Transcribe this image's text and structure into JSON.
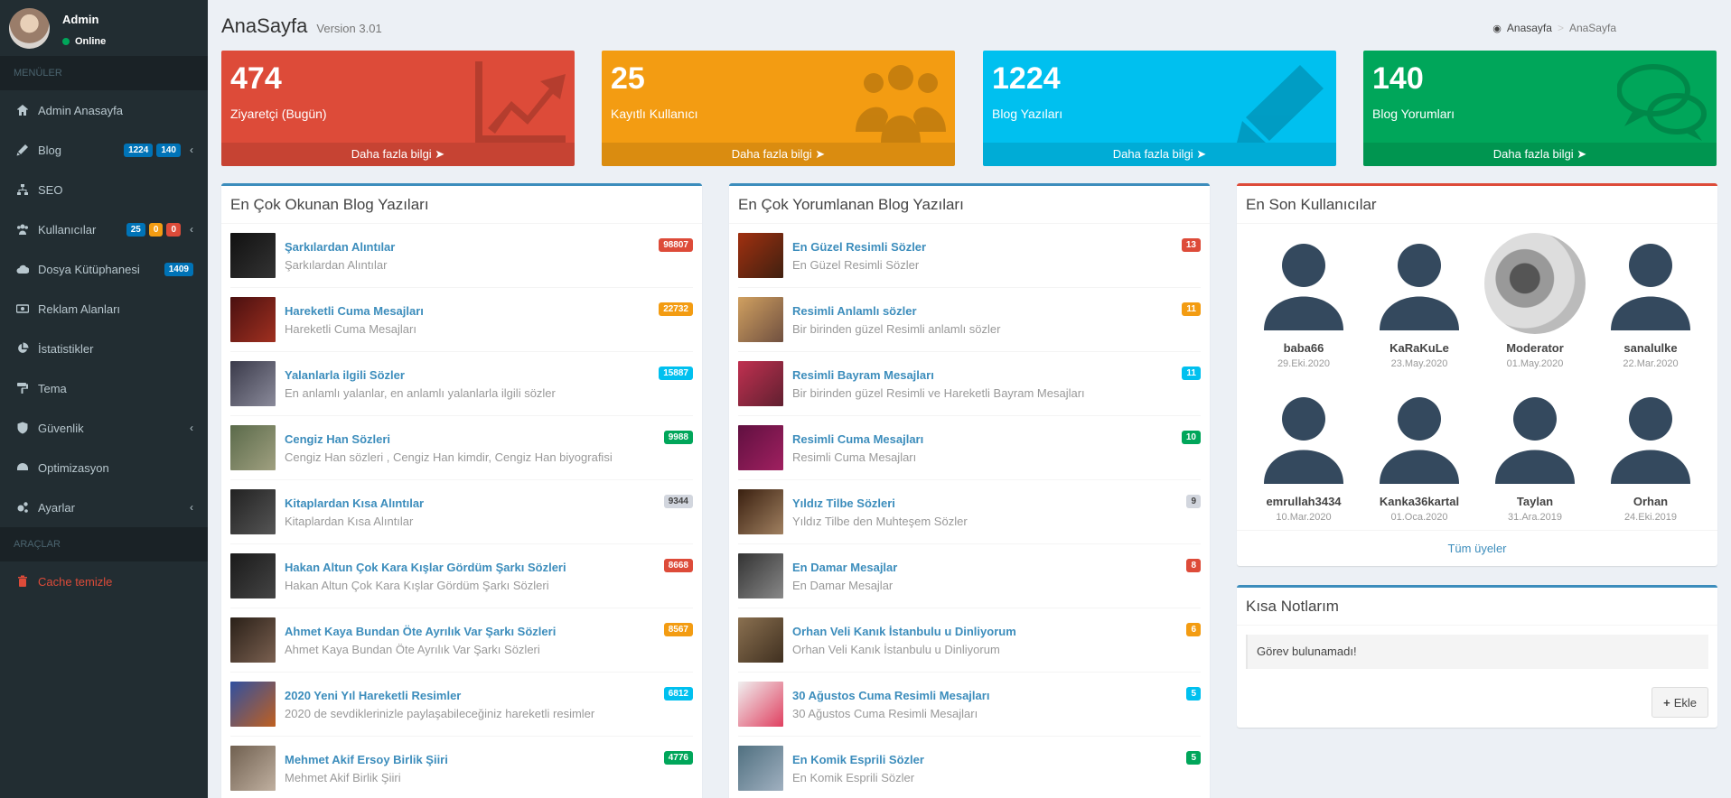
{
  "sidebar": {
    "user": {
      "name": "Admin",
      "status": "Online"
    },
    "header_menu": "MENÜLER",
    "header_tools": "ARAÇLAR",
    "items": [
      {
        "label": "Admin Anasayfa",
        "icon": "dashboard-icon"
      },
      {
        "label": "Blog",
        "icon": "pencil-icon",
        "badges": [
          "1224",
          "140"
        ]
      },
      {
        "label": "SEO",
        "icon": "sitemap-icon"
      },
      {
        "label": "Kullanıcılar",
        "icon": "users-icon",
        "badges": [
          "25",
          "0",
          "0"
        ]
      },
      {
        "label": "Dosya Kütüphanesi",
        "icon": "cloud-upload-icon",
        "badges": [
          "1409"
        ]
      },
      {
        "label": "Reklam Alanları",
        "icon": "money-icon"
      },
      {
        "label": "İstatistikler",
        "icon": "pie-chart-icon"
      },
      {
        "label": "Tema",
        "icon": "paint-roller-icon"
      },
      {
        "label": "Güvenlik",
        "icon": "shield-icon"
      },
      {
        "label": "Optimizasyon",
        "icon": "tachometer-icon"
      },
      {
        "label": "Ayarlar",
        "icon": "gears-icon"
      }
    ],
    "cache_label": "Cache temizle"
  },
  "header": {
    "title": "AnaSayfa",
    "version": "Version 3.01"
  },
  "breadcrumb": {
    "home": "Anasayfa",
    "sep": ">",
    "current": "AnaSayfa"
  },
  "stats": [
    {
      "value": "474",
      "label": "Ziyaretçi (Bugün)",
      "more": "Daha fazla bilgi",
      "color": "#dd4b39"
    },
    {
      "value": "25",
      "label": "Kayıtlı Kullanıcı",
      "more": "Daha fazla bilgi",
      "color": "#f39c12"
    },
    {
      "value": "1224",
      "label": "Blog Yazıları",
      "more": "Daha fazla bilgi",
      "color": "#00c0ef"
    },
    {
      "value": "140",
      "label": "Blog Yorumları",
      "more": "Daha fazla bilgi",
      "color": "#00a65a"
    }
  ],
  "most_read": {
    "title": "En Çok Okunan Blog Yazıları",
    "posts": [
      {
        "title": "Şarkılardan Alıntılar",
        "desc": "Şarkılardan Alıntılar",
        "count": "98807",
        "badge": "red"
      },
      {
        "title": "Hareketli Cuma Mesajları",
        "desc": "Hareketli Cuma Mesajları",
        "count": "22732",
        "badge": "orange"
      },
      {
        "title": "Yalanlarla ilgili Sözler",
        "desc": "En anlamlı yalanlar, en anlamlı yalanlarla ilgili sözler",
        "count": "15887",
        "badge": "aqua"
      },
      {
        "title": "Cengiz Han Sözleri",
        "desc": "Cengiz Han sözleri , Cengiz Han kimdir, Cengiz Han biyografisi",
        "count": "9988",
        "badge": "green"
      },
      {
        "title": "Kitaplardan Kısa Alıntılar",
        "desc": "Kitaplardan Kısa Alıntılar",
        "count": "9344",
        "badge": "gray"
      },
      {
        "title": "Hakan Altun Çok Kara Kışlar Gördüm Şarkı Sözleri",
        "desc": "Hakan Altun Çok Kara Kışlar Gördüm Şarkı Sözleri",
        "count": "8668",
        "badge": "red"
      },
      {
        "title": "Ahmet Kaya Bundan Öte Ayrılık Var Şarkı Sözleri",
        "desc": "Ahmet Kaya Bundan Öte Ayrılık Var Şarkı Sözleri",
        "count": "8567",
        "badge": "orange"
      },
      {
        "title": "2020 Yeni Yıl Hareketli Resimler",
        "desc": "2020 de sevdiklerinizle paylaşabileceğiniz hareketli resimler",
        "count": "6812",
        "badge": "aqua"
      },
      {
        "title": "Mehmet Akif Ersoy Birlik Şiiri",
        "desc": "Mehmet Akif Birlik Şiiri",
        "count": "4776",
        "badge": "green"
      }
    ]
  },
  "most_commented": {
    "title": "En Çok Yorumlanan Blog Yazıları",
    "posts": [
      {
        "title": "En Güzel Resimli Sözler",
        "desc": "En Güzel Resimli Sözler",
        "count": "13",
        "badge": "red"
      },
      {
        "title": "Resimli Anlamlı sözler",
        "desc": "Bir birinden güzel Resimli anlamlı sözler",
        "count": "11",
        "badge": "orange"
      },
      {
        "title": "Resimli Bayram Mesajları",
        "desc": "Bir birinden güzel Resimli ve Hareketli Bayram Mesajları",
        "count": "11",
        "badge": "aqua"
      },
      {
        "title": "Resimli Cuma Mesajları",
        "desc": "Resimli Cuma Mesajları",
        "count": "10",
        "badge": "green"
      },
      {
        "title": "Yıldız Tilbe Sözleri",
        "desc": "Yıldız Tilbe den Muhteşem Sözler",
        "count": "9",
        "badge": "gray"
      },
      {
        "title": "En Damar Mesajlar",
        "desc": "En Damar Mesajlar",
        "count": "8",
        "badge": "red"
      },
      {
        "title": "Orhan Veli Kanık İstanbulu u Dinliyorum",
        "desc": "Orhan Veli Kanık İstanbulu u Dinliyorum",
        "count": "6",
        "badge": "orange"
      },
      {
        "title": "30 Ağustos Cuma Resimli Mesajları",
        "desc": "30 Ağustos Cuma Resimli Mesajları",
        "count": "5",
        "badge": "aqua"
      },
      {
        "title": "En Komik Esprili Sözler",
        "desc": "En Komik Esprili Sözler",
        "count": "5",
        "badge": "green"
      }
    ]
  },
  "latest_users": {
    "title": "En Son Kullanıcılar",
    "users": [
      {
        "name": "baba66",
        "date": "29.Eki.2020",
        "photo": false
      },
      {
        "name": "KaRaKuLe",
        "date": "23.May.2020",
        "photo": false
      },
      {
        "name": "Moderator",
        "date": "01.May.2020",
        "photo": true
      },
      {
        "name": "sanalulke",
        "date": "22.Mar.2020",
        "photo": false
      },
      {
        "name": "emrullah3434",
        "date": "10.Mar.2020",
        "photo": false
      },
      {
        "name": "Kanka36kartal",
        "date": "01.Oca.2020",
        "photo": false
      },
      {
        "name": "Taylan",
        "date": "31.Ara.2019",
        "photo": false
      },
      {
        "name": "Orhan",
        "date": "24.Eki.2019",
        "photo": false
      }
    ],
    "all_link": "Tüm üyeler"
  },
  "notes": {
    "title": "Kısa Notlarım",
    "empty": "Görev bulunamadı!",
    "add_label": "Ekle"
  }
}
